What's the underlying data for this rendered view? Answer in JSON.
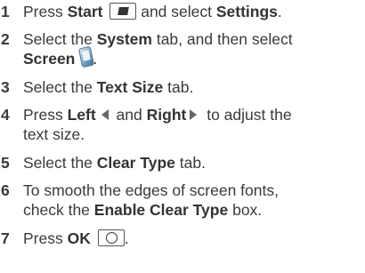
{
  "steps": [
    {
      "num": "1",
      "t1": "Press ",
      "b1": "Start",
      "t2": " and select ",
      "b2": "Settings",
      "t3": "."
    },
    {
      "num": "2",
      "t1": "Select the ",
      "b1": "System",
      "t2": " tab, and then select",
      "b2": "Screen",
      "t3": "."
    },
    {
      "num": "3",
      "t1": "Select the ",
      "b1": "Text Size",
      "t2": " tab."
    },
    {
      "num": "4",
      "t1": "Press ",
      "b1": "Left",
      "t2": " and ",
      "b2": "Right",
      "t3": " to adjust the",
      "t4": "text size."
    },
    {
      "num": "5",
      "t1": "Select the ",
      "b1": "Clear Type",
      "t2": " tab."
    },
    {
      "num": "6",
      "t1": "To smooth the edges of screen fonts,",
      "t2": "check the ",
      "b1": "Enable Clear Type",
      "t3": " box."
    },
    {
      "num": "7",
      "t1": "Press ",
      "b1": "OK",
      "t2": "."
    }
  ],
  "icons": {
    "start_key": "windows-start-key-icon",
    "screen": "screen-settings-icon",
    "left_arrow": "left-arrow-icon",
    "right_arrow": "right-arrow-icon",
    "ok_key": "ok-key-icon"
  },
  "colors": {
    "text": "#3a3a3a"
  }
}
